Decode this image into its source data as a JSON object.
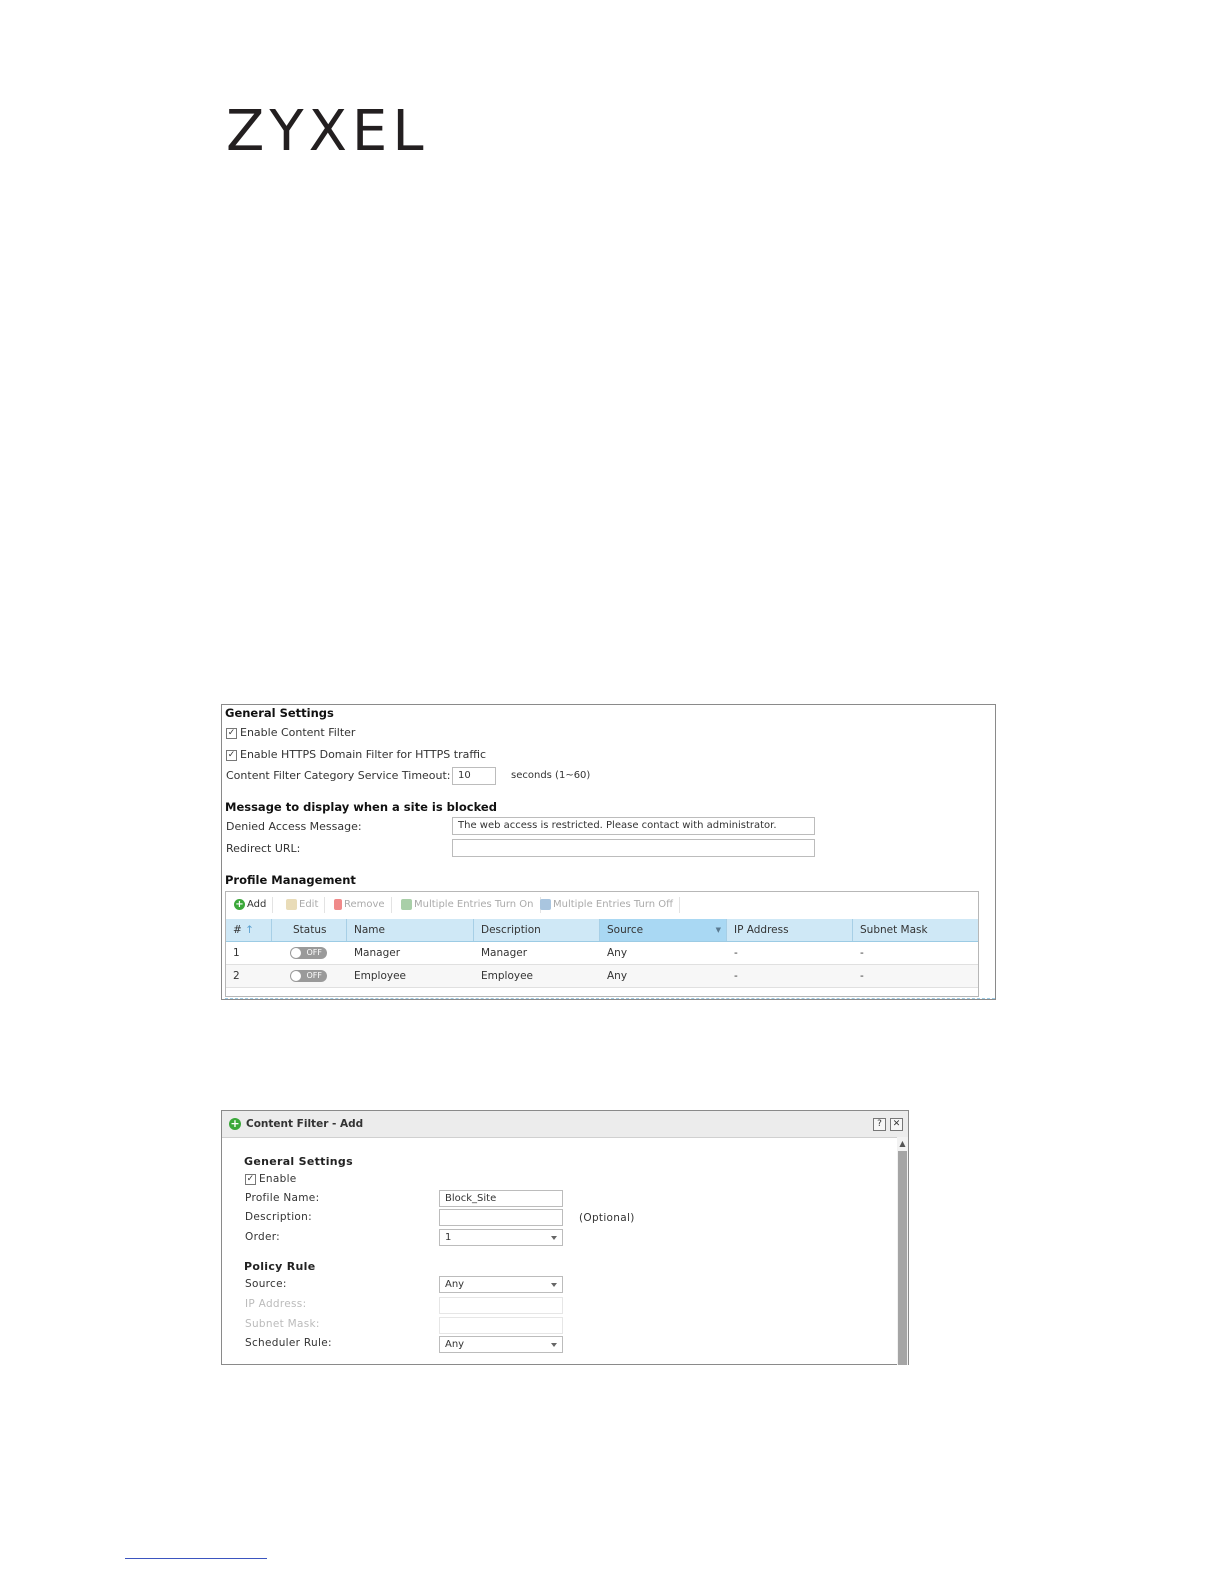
{
  "logo": {
    "text": "ZYXEL"
  },
  "panel1": {
    "general_title": "General Settings",
    "enable_content_filter": "Enable Content Filter",
    "enable_https": "Enable HTTPS Domain Filter for HTTPS traffic",
    "timeout_label": "Content Filter Category Service Timeout:",
    "timeout_value": "10",
    "timeout_unit": "seconds (1~60)",
    "message_title": "Message to display when a site is blocked",
    "denied_label": "Denied Access Message:",
    "denied_value": "The web access is restricted. Please contact with administrator.",
    "redirect_label": "Redirect URL:",
    "redirect_value": "",
    "profile_title": "Profile Management",
    "toolbar": {
      "add": "Add",
      "edit": "Edit",
      "remove": "Remove",
      "multi_on": "Multiple Entries Turn On",
      "multi_off": "Multiple Entries Turn Off"
    },
    "columns": [
      "#",
      "Status",
      "Name",
      "Description",
      "Source",
      "IP Address",
      "Subnet Mask"
    ],
    "rows": [
      {
        "num": "1",
        "status": "OFF",
        "name": "Manager",
        "description": "Manager",
        "source": "Any",
        "ip": "-",
        "mask": "-"
      },
      {
        "num": "2",
        "status": "OFF",
        "name": "Employee",
        "description": "Employee",
        "source": "Any",
        "ip": "-",
        "mask": "-"
      }
    ]
  },
  "panel2": {
    "title": "Content Filter - Add",
    "help": "?",
    "close": "✕",
    "general_title": "General Settings",
    "enable": "Enable",
    "profile_name_label": "Profile Name:",
    "profile_name_value": "Block_Site",
    "description_label": "Description:",
    "description_value": "",
    "optional": "(Optional)",
    "order_label": "Order:",
    "order_value": "1",
    "policy_title": "Policy Rule",
    "source_label": "Source:",
    "source_value": "Any",
    "ip_label": "IP Address:",
    "mask_label": "Subnet Mask:",
    "scheduler_label": "Scheduler Rule:",
    "scheduler_value": "Any"
  }
}
